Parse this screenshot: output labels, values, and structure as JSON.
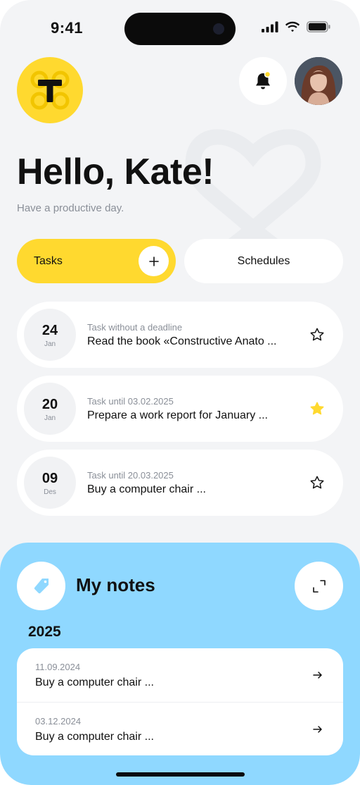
{
  "status_bar": {
    "time": "9:41"
  },
  "header": {
    "logo_letter": "T",
    "greeting": "Hello, Kate!",
    "subtitle": "Have a productive day."
  },
  "tabs": [
    {
      "label": "Tasks",
      "active": true
    },
    {
      "label": "Schedules",
      "active": false
    }
  ],
  "tasks": [
    {
      "day": "24",
      "month": "Jan",
      "meta": "Task without a deadline",
      "title": "Read the book «Constructive Anato ...",
      "starred": false
    },
    {
      "day": "20",
      "month": "Jan",
      "meta": "Task until 03.02.2025",
      "title": "Prepare a work report for January ...",
      "starred": true
    },
    {
      "day": "09",
      "month": "Des",
      "meta": "Task until 20.03.2025",
      "title": "Buy a computer chair ...",
      "starred": false
    }
  ],
  "notes": {
    "title": "My notes",
    "year": "2025",
    "items": [
      {
        "date": "11.09.2024",
        "title": "Buy a computer chair ..."
      },
      {
        "date": "03.12.2024",
        "title": "Buy a computer chair ..."
      }
    ]
  },
  "icons": {
    "bell": "bell-icon",
    "notification_dot": "#ffd92f",
    "star_filled_color": "#ffd92f",
    "tag": "tag-icon",
    "expand": "expand-icon",
    "arrow": "arrow-right-icon"
  },
  "colors": {
    "accent": "#ffd92f",
    "notes_bg": "#8fd8ff",
    "page_bg": "#f3f4f6"
  }
}
